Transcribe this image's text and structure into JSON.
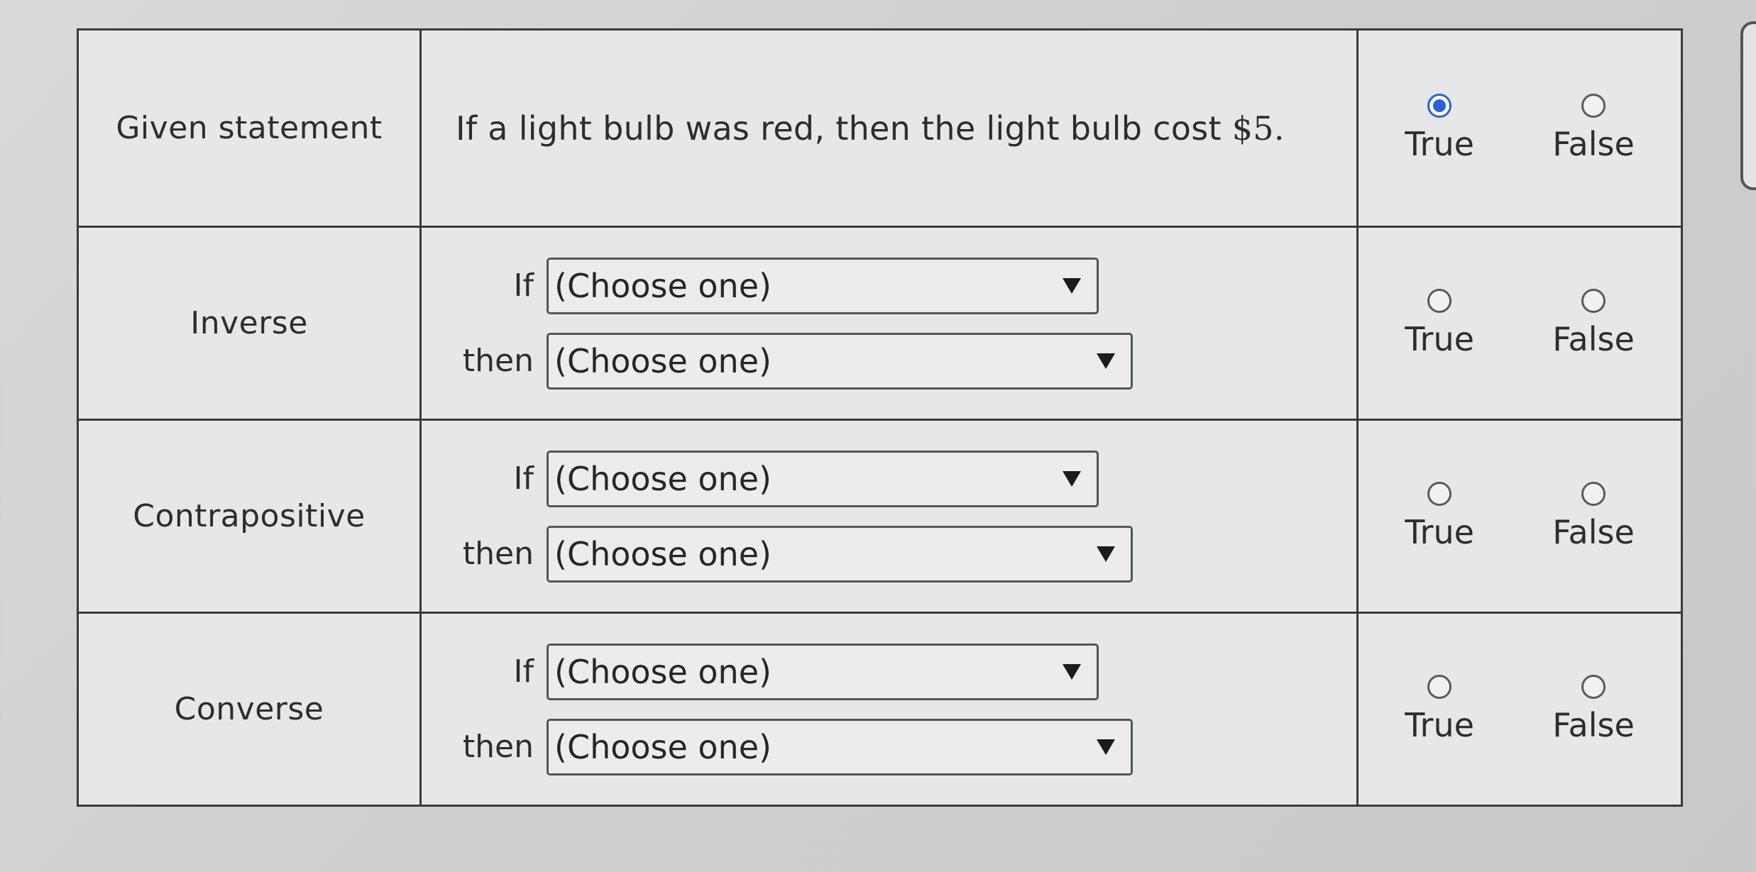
{
  "given": {
    "label": "Given statement",
    "statement_text": "If a light bulb was red, then the light bulb cost ",
    "statement_money": "$5."
  },
  "tf": {
    "true_label": "True",
    "false_label": "False"
  },
  "rows": [
    {
      "label": "Inverse",
      "if_prefix": "If",
      "then_prefix": "then",
      "if_value": "(Choose one)",
      "then_value": "(Choose one)",
      "selected": null
    },
    {
      "label": "Contrapositive",
      "if_prefix": "If",
      "then_prefix": "then",
      "if_value": "(Choose one)",
      "then_value": "(Choose one)",
      "selected": null
    },
    {
      "label": "Converse",
      "if_prefix": "If",
      "then_prefix": "then",
      "if_value": "(Choose one)",
      "then_value": "(Choose one)",
      "selected": null
    }
  ],
  "given_selected": "True",
  "colors": {
    "radio_selected": "#2d5fd6",
    "border": "#3a3a3a",
    "background": "#e6e7e8"
  }
}
